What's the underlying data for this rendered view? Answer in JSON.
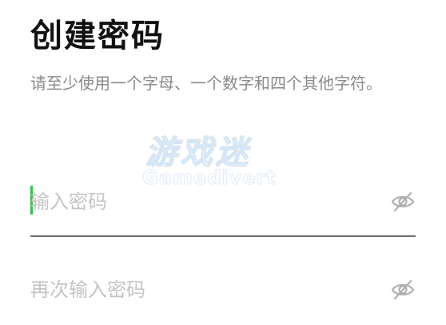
{
  "header": {
    "title": "创建密码",
    "subtitle": "请至少使用一个字母、一个数字和四个其他字符。"
  },
  "watermark": {
    "cn": "游戏迷",
    "en": "Gamedivert"
  },
  "form": {
    "password": {
      "placeholder": "输入密码",
      "value": ""
    },
    "confirm": {
      "placeholder": "再次输入密码",
      "value": ""
    }
  },
  "icons": {
    "visibility": "eye-off-icon"
  },
  "colors": {
    "caret": "#2fc24a",
    "placeholder": "#c4c4c4",
    "title": "#111111",
    "subtitle": "#8a8a8a"
  }
}
